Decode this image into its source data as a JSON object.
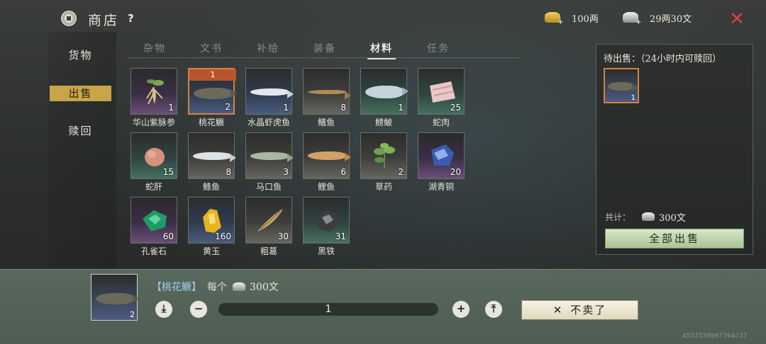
{
  "header": {
    "title": "商店",
    "help": "?",
    "gold": "100两",
    "silver": "29两30文",
    "gold_plus": "+",
    "silver_plus": "+"
  },
  "sidebar": {
    "items": [
      {
        "label": "货物"
      },
      {
        "label": "出售"
      },
      {
        "label": "赎回"
      }
    ],
    "active_index": 1
  },
  "tabs": [
    {
      "label": "杂物"
    },
    {
      "label": "文书"
    },
    {
      "label": "补给"
    },
    {
      "label": "装备"
    },
    {
      "label": "材料"
    },
    {
      "label": "任务"
    }
  ],
  "active_tab": "材料",
  "items": [
    {
      "name": "华山紫脉参",
      "count": "1",
      "rarity": "purple",
      "icon": "ginseng-icon"
    },
    {
      "name": "桃花鳜",
      "count": "2",
      "rarity": "blue",
      "icon": "mandarin-fish-icon",
      "selected_count": "1"
    },
    {
      "name": "水晶虾虎鱼",
      "count": "1",
      "rarity": "blue",
      "icon": "goby-fish-icon"
    },
    {
      "name": "鳝鱼",
      "count": "8",
      "rarity": "white",
      "icon": "eel-icon"
    },
    {
      "name": "鳑鲏",
      "count": "1",
      "rarity": "green",
      "icon": "bitterling-fish-icon"
    },
    {
      "name": "蛇肉",
      "count": "25",
      "rarity": "green",
      "icon": "snake-meat-icon"
    },
    {
      "name": "蛇肝",
      "count": "15",
      "rarity": "green",
      "icon": "snake-liver-icon"
    },
    {
      "name": "鲦鱼",
      "count": "8",
      "rarity": "white",
      "icon": "minnow-fish-icon"
    },
    {
      "name": "马口鱼",
      "count": "3",
      "rarity": "white",
      "icon": "chub-fish-icon"
    },
    {
      "name": "鲤鱼",
      "count": "6",
      "rarity": "white",
      "icon": "carp-fish-icon"
    },
    {
      "name": "草药",
      "count": "2",
      "rarity": "white",
      "icon": "herb-icon"
    },
    {
      "name": "湖青铜",
      "count": "20",
      "rarity": "purple",
      "icon": "bronze-ore-icon"
    },
    {
      "name": "孔雀石",
      "count": "60",
      "rarity": "purple",
      "icon": "malachite-icon"
    },
    {
      "name": "黄玉",
      "count": "160",
      "rarity": "blue",
      "icon": "topaz-icon"
    },
    {
      "name": "粗葛",
      "count": "30",
      "rarity": "white",
      "icon": "kudzu-root-icon"
    },
    {
      "name": "黑铁",
      "count": "31",
      "rarity": "green",
      "icon": "black-iron-icon"
    }
  ],
  "pending": {
    "title": "待出售：（24小时内可赎回）",
    "item_count": "1",
    "total_label": "共计：",
    "total_value": "300文",
    "sell_all": "全部出售"
  },
  "detail": {
    "item_name": "【桃花鳜】",
    "each_label": "每个",
    "price": "300文",
    "owned": "2",
    "quantity": "1",
    "cancel": "不卖了",
    "cancel_icon": "✕"
  },
  "uid": "4557558987764737"
}
